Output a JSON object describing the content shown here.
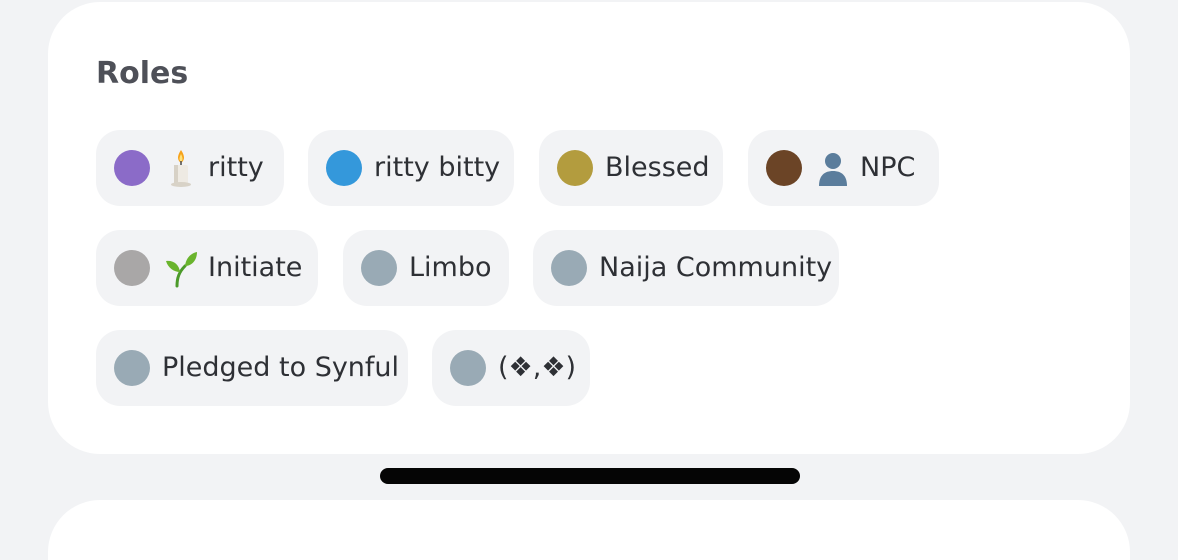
{
  "section": {
    "title": "Roles"
  },
  "roles": [
    {
      "name": "ritty",
      "color": "#8b6bc8",
      "emoji": "candle-icon"
    },
    {
      "name": "ritty bitty",
      "color": "#3498db",
      "emoji": null
    },
    {
      "name": "Blessed",
      "color": "#b39c3e",
      "emoji": null
    },
    {
      "name": "NPC",
      "color": "#6b4426",
      "emoji": "bust-in-silhouette-icon"
    },
    {
      "name": "Initiate",
      "color": "#a9a7a7",
      "emoji": "seedling-icon"
    },
    {
      "name": "Limbo",
      "color": "#99aab5",
      "emoji": null
    },
    {
      "name": "Naija Community",
      "color": "#99aab5",
      "emoji": null
    },
    {
      "name": "Pledged to Synful",
      "color": "#99aab5",
      "emoji": null
    },
    {
      "name": "(❖,❖)",
      "color": "#99aab5",
      "emoji": null
    }
  ]
}
